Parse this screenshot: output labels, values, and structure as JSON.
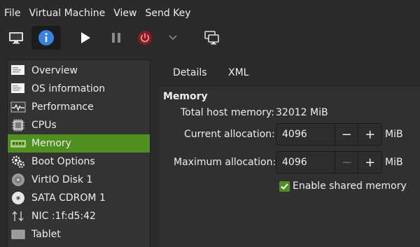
{
  "menubar": {
    "items": [
      "File",
      "Virtual Machine",
      "View",
      "Send Key"
    ]
  },
  "toolbar": {
    "buttons": [
      {
        "icon": "monitor-icon",
        "active": false
      },
      {
        "icon": "info-icon",
        "active": true
      },
      {
        "icon": "play-icon",
        "active": false
      },
      {
        "icon": "pause-icon",
        "active": false
      },
      {
        "icon": "power-icon",
        "active": false
      },
      {
        "icon": "chevron-down-icon",
        "active": false
      },
      {
        "icon": "snapshots-icon",
        "active": false
      }
    ]
  },
  "sidebar": {
    "items": [
      {
        "label": "Overview",
        "icon": "overview-icon"
      },
      {
        "label": "OS information",
        "icon": "os-info-icon"
      },
      {
        "label": "Performance",
        "icon": "performance-icon"
      },
      {
        "label": "CPUs",
        "icon": "cpu-icon"
      },
      {
        "label": "Memory",
        "icon": "memory-icon",
        "selected": true
      },
      {
        "label": "Boot Options",
        "icon": "boot-options-icon"
      },
      {
        "label": "VirtIO Disk 1",
        "icon": "disk-icon"
      },
      {
        "label": "SATA CDROM 1",
        "icon": "cdrom-icon"
      },
      {
        "label": "NIC :1f:d5:42",
        "icon": "nic-icon"
      },
      {
        "label": "Tablet",
        "icon": "tablet-icon"
      }
    ]
  },
  "tabs": {
    "details": "Details",
    "xml": "XML"
  },
  "memory": {
    "title": "Memory",
    "total_label": "Total host memory:",
    "total_value": "32012 MiB",
    "current_label": "Current allocation:",
    "current_value": "4096",
    "maximum_label": "Maximum allocation:",
    "maximum_value": "4096",
    "unit": "MiB",
    "minus": "−",
    "plus": "+",
    "shared_label": "Enable shared memory",
    "shared_checked": true
  },
  "colors": {
    "accent": "#4e8f1f",
    "background": "#2b2b2b",
    "power": "#c01c28",
    "info": "#3584e4"
  }
}
